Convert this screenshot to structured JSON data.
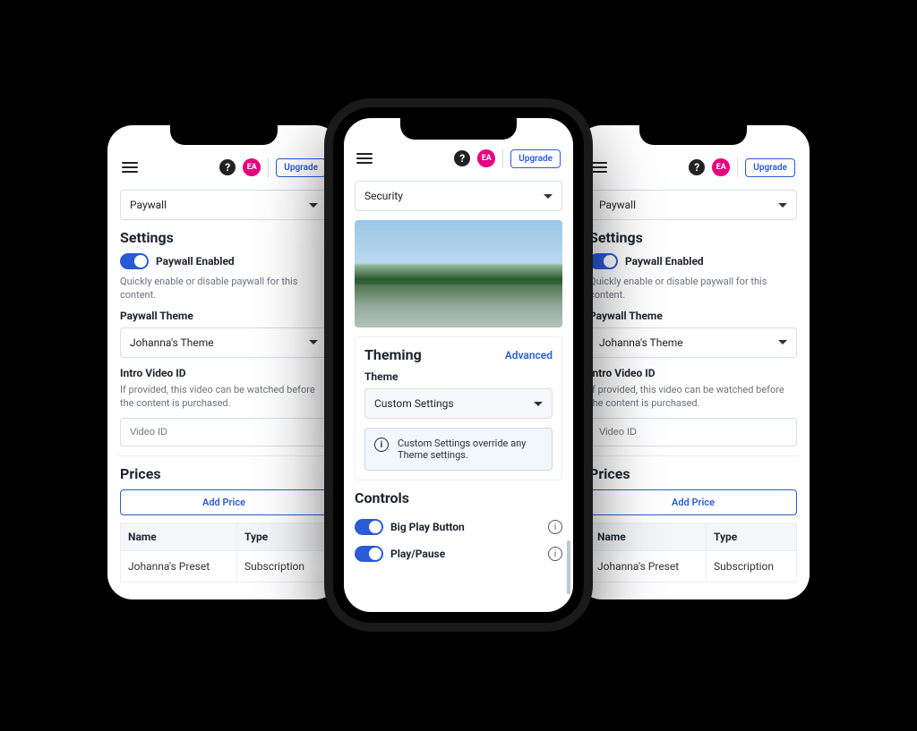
{
  "header": {
    "avatar_initials": "EA",
    "upgrade_label": "Upgrade"
  },
  "paywall_screen": {
    "selector_value": "Paywall",
    "settings_title": "Settings",
    "paywall_enabled_label": "Paywall Enabled",
    "paywall_enabled_helper": "Quickly enable or disable paywall for this content.",
    "theme_label": "Paywall Theme",
    "theme_value": "Johanna's Theme",
    "intro_label": "Intro Video ID",
    "intro_helper": "If provided, this video can be watched before the content is purchased.",
    "intro_placeholder": "Video ID",
    "prices_title": "Prices",
    "add_price_label": "Add Price",
    "table": {
      "col_name": "Name",
      "col_type": "Type",
      "row_name": "Johanna's Preset",
      "row_type": "Subscription"
    }
  },
  "theming_screen": {
    "selector_value": "Security",
    "theming_title": "Theming",
    "advanced_label": "Advanced",
    "theme_label": "Theme",
    "theme_value": "Custom Settings",
    "info_text": "Custom Settings override any Theme settings.",
    "controls_title": "Controls",
    "controls": {
      "big_play": "Big Play Button",
      "play_pause": "Play/Pause"
    }
  }
}
